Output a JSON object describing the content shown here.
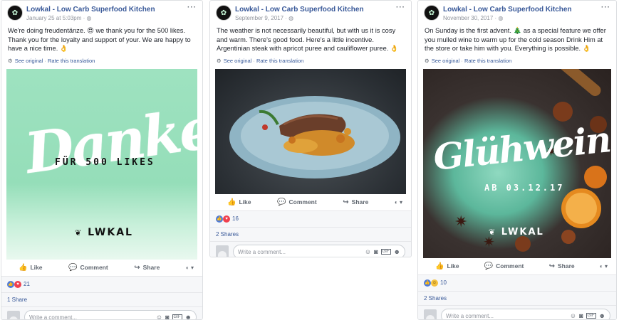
{
  "posts": [
    {
      "page_name": "Lowkal - Low Carb Superfood Kitchen",
      "date": "January 25 at 5:03pm",
      "text": "We're doing freudentänze. 😍 we thank you for the 500 likes. Thank you for the loyalty and support of your. We are happy to have a nice time. 👌",
      "see_original": "See original",
      "rate_translation": "Rate this translation",
      "image": {
        "headline": "Danke!",
        "subline": "FÜR 500 LIKES",
        "logo": "LWKAL"
      },
      "actions": {
        "like": "Like",
        "comment": "Comment",
        "share": "Share"
      },
      "reaction_count": "21",
      "shares": "1 Share",
      "comment_placeholder": "Write a comment..."
    },
    {
      "page_name": "Lowkal - Low Carb Superfood Kitchen",
      "date": "September 9, 2017",
      "text": "The weather is not necessarily beautiful, but with us it is cosy and warm. There's good food. Here's a little incentive. Argentinian steak with apricot puree and cauliflower puree. 👌",
      "see_original": "See original",
      "rate_translation": "Rate this translation",
      "actions": {
        "like": "Like",
        "comment": "Comment",
        "share": "Share"
      },
      "reaction_count": "16",
      "shares": "2 Shares",
      "comment_placeholder": "Write a comment..."
    },
    {
      "page_name": "Lowkal - Low Carb Superfood Kitchen",
      "date": "November 30, 2017",
      "text": "On Sunday is the first advent. 🎄 as a special feature we offer you mulled wine to warm up for the cold season Drink Him at the store or take him with you. Everything is possible. 👌",
      "see_original": "See original",
      "rate_translation": "Rate this translation",
      "image": {
        "headline": "Glühwein",
        "subline": "AB 03.12.17",
        "logo": "LWKAL"
      },
      "actions": {
        "like": "Like",
        "comment": "Comment",
        "share": "Share"
      },
      "reaction_count": "10",
      "shares": "2 Shares",
      "comment_placeholder": "Write a comment..."
    }
  ],
  "icons": {
    "globe": "⚙",
    "like": "👍",
    "comment": "💬",
    "share": "↪",
    "more": "⋯",
    "emoji": "☺",
    "camera": "📷",
    "gif": "GIF",
    "sticker": "▣"
  }
}
